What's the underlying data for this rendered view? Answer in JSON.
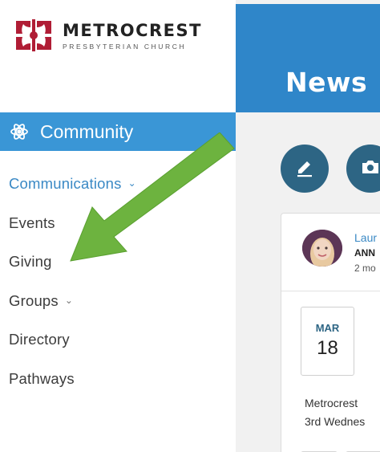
{
  "brand": {
    "name": "METROCREST",
    "subtitle": "PRESBYTERIAN CHURCH",
    "color": "#b01d35"
  },
  "sidebar": {
    "section_title": "Community",
    "section_icon": "atom-icon",
    "items": [
      {
        "label": "Communications",
        "has_submenu": true,
        "active": true
      },
      {
        "label": "Events",
        "has_submenu": false
      },
      {
        "label": "Giving",
        "has_submenu": false
      },
      {
        "label": "Groups",
        "has_submenu": true
      },
      {
        "label": "Directory",
        "has_submenu": false
      },
      {
        "label": "Pathways",
        "has_submenu": false
      }
    ],
    "chevron": "⌄"
  },
  "main": {
    "title": "News",
    "actions": [
      {
        "icon": "pencil-icon"
      },
      {
        "icon": "camera-icon"
      }
    ],
    "post": {
      "author": "Laur",
      "tag": "ANN",
      "time": "2 mo",
      "date_month": "MAR",
      "date_day": "18",
      "text_lines": [
        "Metrocrest",
        "3rd Wednes"
      ]
    }
  },
  "colors": {
    "accent": "#3a96d6",
    "header": "#2f86c9",
    "button": "#2d6584",
    "arrow": "#6db33f"
  }
}
